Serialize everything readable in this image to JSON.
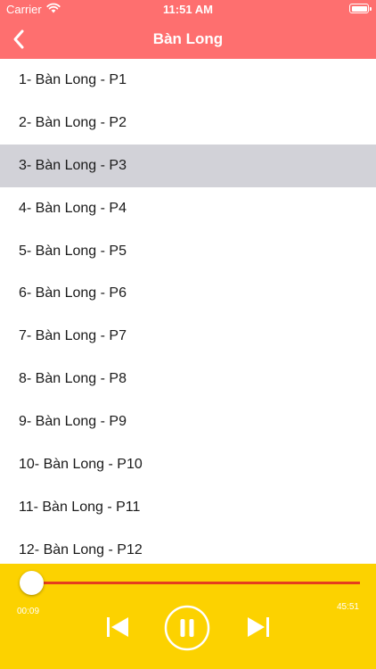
{
  "status_bar": {
    "carrier": "Carrier",
    "time": "11:51 AM"
  },
  "nav": {
    "title": "Bàn Long",
    "back_icon": "chevron-left-icon"
  },
  "episodes": [
    {
      "label": "1- Bàn Long - P1",
      "selected": false
    },
    {
      "label": "2- Bàn Long - P2",
      "selected": false
    },
    {
      "label": "3- Bàn Long - P3",
      "selected": true
    },
    {
      "label": "4- Bàn Long - P4",
      "selected": false
    },
    {
      "label": "5- Bàn Long - P5",
      "selected": false
    },
    {
      "label": "6- Bàn Long - P6",
      "selected": false
    },
    {
      "label": "7- Bàn Long - P7",
      "selected": false
    },
    {
      "label": "8- Bàn Long - P8",
      "selected": false
    },
    {
      "label": "9- Bàn Long - P9",
      "selected": false
    },
    {
      "label": "10- Bàn Long - P10",
      "selected": false
    },
    {
      "label": "11- Bàn Long - P11",
      "selected": false
    },
    {
      "label": "12- Bàn Long - P12",
      "selected": false
    }
  ],
  "player": {
    "current_time": "00:09",
    "total_time": "45:51",
    "progress_fraction": 0.003,
    "icons": {
      "previous": "skip-previous-icon",
      "pause": "pause-icon",
      "next": "skip-next-icon"
    }
  },
  "colors": {
    "header": "#fe6f6f",
    "player_background": "#fcd200",
    "progress_track": "#e53e1d",
    "selected_row": "#d2d2d8"
  }
}
